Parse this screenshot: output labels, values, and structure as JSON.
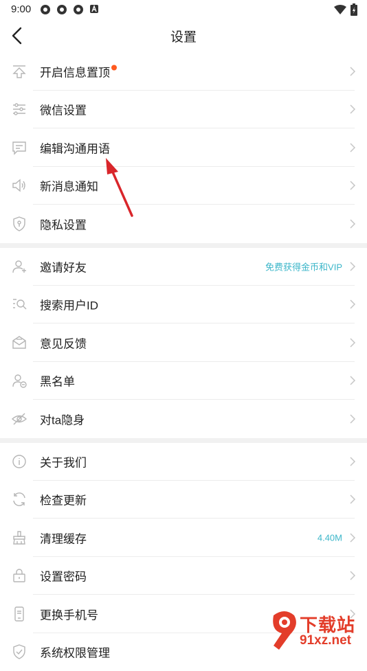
{
  "status": {
    "time": "9:00"
  },
  "header": {
    "title": "设置"
  },
  "groups": [
    {
      "items": [
        {
          "label": "开启信息置顶",
          "extra": ""
        },
        {
          "label": "微信设置",
          "extra": ""
        },
        {
          "label": "编辑沟通用语",
          "extra": ""
        },
        {
          "label": "新消息通知",
          "extra": ""
        },
        {
          "label": "隐私设置",
          "extra": ""
        }
      ]
    },
    {
      "items": [
        {
          "label": "邀请好友",
          "extra": "免费获得金币和VIP"
        },
        {
          "label": "搜索用户ID",
          "extra": ""
        },
        {
          "label": "意见反馈",
          "extra": ""
        },
        {
          "label": "黑名单",
          "extra": ""
        },
        {
          "label": "对ta隐身",
          "extra": ""
        }
      ]
    },
    {
      "items": [
        {
          "label": "关于我们",
          "extra": ""
        },
        {
          "label": "检查更新",
          "extra": ""
        },
        {
          "label": "清理缓存",
          "extra": "4.40M"
        },
        {
          "label": "设置密码",
          "extra": ""
        },
        {
          "label": "更换手机号",
          "extra": ""
        },
        {
          "label": "系统权限管理",
          "extra": ""
        }
      ]
    }
  ],
  "watermark": {
    "line1": "下载站",
    "line2": "91xz.net"
  },
  "colors": {
    "accent": "#3bb6c9",
    "badge": "#ff5a1f",
    "arrow": "#d9262b",
    "watermark": "#e33d2a"
  }
}
